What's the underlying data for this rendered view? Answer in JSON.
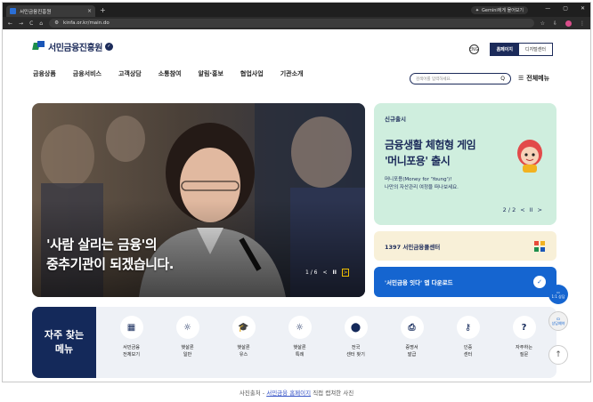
{
  "browser": {
    "tab_title": "서민금융진흥원",
    "close_tab": "×",
    "new_tab": "+",
    "gemini_button": "Gemini에게 물어보기",
    "window_controls": [
      "—",
      "▢",
      "✕"
    ],
    "nav_buttons": [
      "←",
      "→",
      "C",
      "⌂"
    ],
    "url": "kinfa.or.kr/main.do",
    "toolbar_icons": [
      "☆",
      "⇩"
    ]
  },
  "header": {
    "logo_text": "서민금융진흥원",
    "logo_badge": "✓",
    "language_icon": "ENG",
    "mode_on": "홈페이지",
    "mode_off": "디지털센터"
  },
  "nav": {
    "items": [
      "금융상품",
      "금융서비스",
      "고객상담",
      "소통참여",
      "알림·홍보",
      "협업사업",
      "기관소개"
    ],
    "search_placeholder": "검색어를 입력하세요.",
    "search_icon": "Q",
    "all_menu": "전체메뉴"
  },
  "hero": {
    "caption_line1": "'사람 살리는 금융'의",
    "caption_line2": "중추기관이 되겠습니다.",
    "page": "1 / 6",
    "prev": "<",
    "pause": "II",
    "next": ">"
  },
  "promo": {
    "tag": "신규출시",
    "headline_line1": "금융생활 체험형 게임",
    "headline_line2": "'머니포용' 출시",
    "desc_line1": "머니포용(Money for 'Young')!",
    "desc_line2": "나만의 자산관리 여정을 떠나보세요.",
    "page": "2 / 2",
    "prev": "<",
    "pause": "II",
    "next": ">"
  },
  "center": {
    "label": "1397 서민금융콜센터"
  },
  "app": {
    "label": "'서민금융 잇다' 앱 다운로드",
    "icon": "✓"
  },
  "quick": {
    "title_line1": "자주 찾는",
    "title_line2": "메뉴",
    "items": [
      {
        "label": "서민금융\n전체보기",
        "icon": "▦"
      },
      {
        "label": "햇살론\n일반",
        "icon": "☼"
      },
      {
        "label": "햇살론\n유스",
        "icon": "🎓"
      },
      {
        "label": "햇살론\n특례",
        "icon": "☼"
      },
      {
        "label": "전국\n센터 찾기",
        "icon": "⬤"
      },
      {
        "label": "증명서\n발급",
        "icon": "⎙"
      },
      {
        "label": "인증\n센터",
        "icon": "⚷"
      },
      {
        "label": "자주하는\n질문",
        "icon": "?"
      }
    ]
  },
  "side": {
    "chat": "1:1 상담",
    "booking": "상담예약",
    "top": "↑"
  },
  "caption": {
    "prefix": "사진출처 - ",
    "link": "서민금융 홈페이지",
    "suffix": " 직접 캡쳐한 사진"
  },
  "colors": {
    "navy": "#1c2b5a",
    "blue": "#1565d0",
    "mint": "#cfeede",
    "cream": "#f8f0d8"
  }
}
